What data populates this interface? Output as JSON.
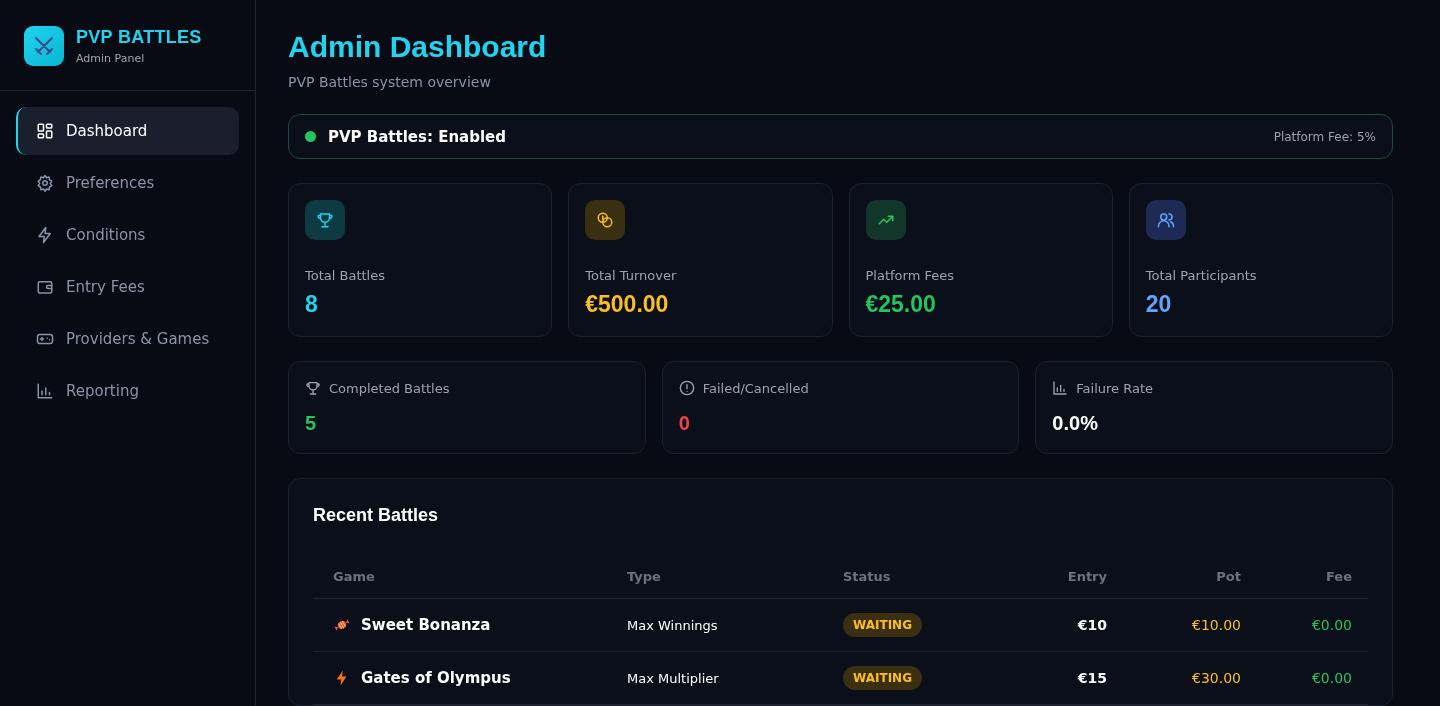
{
  "brand": {
    "title": "PVP BATTLES",
    "subtitle": "Admin Panel"
  },
  "sidebar": {
    "items": [
      {
        "label": "Dashboard",
        "selected": true
      },
      {
        "label": "Preferences",
        "selected": false
      },
      {
        "label": "Conditions",
        "selected": false
      },
      {
        "label": "Entry Fees",
        "selected": false
      },
      {
        "label": "Providers & Games",
        "selected": false
      },
      {
        "label": "Reporting",
        "selected": false
      }
    ]
  },
  "header": {
    "title": "Admin Dashboard",
    "subtitle": "PVP Battles system overview"
  },
  "status_banner": {
    "enabled": true,
    "label": "PVP Battles: Enabled",
    "fee": "Platform Fee: 5%"
  },
  "stats": [
    {
      "label": "Total Battles",
      "value": "8",
      "color": "#22d3ee"
    },
    {
      "label": "Total Turnover",
      "value": "€500.00",
      "color": "#fbbf24"
    },
    {
      "label": "Platform Fees",
      "value": "€25.00",
      "color": "#22c55e"
    },
    {
      "label": "Total Participants",
      "value": "20",
      "color": "#60a5fa"
    }
  ],
  "summary": [
    {
      "label": "Completed Battles",
      "value": "5",
      "color": "#22c55e"
    },
    {
      "label": "Failed/Cancelled",
      "value": "0",
      "color": "#ef4444"
    },
    {
      "label": "Failure Rate",
      "value": "0.0%",
      "color": "#ffffff"
    }
  ],
  "recent_battles": {
    "title": "Recent Battles",
    "columns": [
      "Game",
      "Type",
      "Status",
      "Entry",
      "Pot",
      "Fee"
    ],
    "rows": [
      {
        "game": "Sweet Bonanza",
        "type": "Max Winnings",
        "status": "WAITING",
        "kind": "waiting",
        "entry": "€10",
        "pot": "€10.00",
        "fee": "€0.00"
      },
      {
        "game": "Gates of Olympus",
        "type": "Max Multiplier",
        "status": "WAITING",
        "kind": "waiting",
        "entry": "€15",
        "pot": "€30.00",
        "fee": "€0.00"
      }
    ]
  }
}
